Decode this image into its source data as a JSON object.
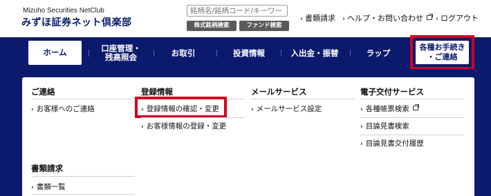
{
  "header": {
    "logo_en": "Mizuho Securities NetClub",
    "logo_ja": "みずほ証券ネット倶楽部",
    "search_placeholder": "銘柄名/銘柄コード/キーワード",
    "btn_stock_search": "株式銘柄検索",
    "btn_fund_search": "ファンド検索",
    "links": {
      "documents": "書類請求",
      "help": "ヘルプ・お問い合わせ",
      "logout": "ログアウト"
    }
  },
  "nav": {
    "home": "ホーム",
    "account_line1": "口座管理・",
    "account_line2": "残高照会",
    "trade": "お取引",
    "invest_info": "投資情報",
    "deposit": "入出金・振替",
    "wrap": "ラップ",
    "procedures_line1": "各種お手続き",
    "procedures_line2": "・ご連絡"
  },
  "menu": {
    "contact": {
      "heading": "ご連絡",
      "items": [
        "お客様へのご連絡"
      ]
    },
    "registration": {
      "heading": "登録情報",
      "items": [
        "登録情報の確認・変更",
        "お客様情報の登録・変更"
      ]
    },
    "mail": {
      "heading": "メールサービス",
      "items": [
        "メールサービス設定"
      ]
    },
    "edelivery": {
      "heading": "電子交付サービス",
      "items": [
        "各種帳票検索",
        "目論見書検索",
        "目論見書交付履歴"
      ]
    },
    "documents": {
      "heading": "書類請求",
      "items": [
        "書類一覧"
      ]
    }
  },
  "colors": {
    "navy": "#0c1a6e",
    "highlight_red": "#d4001e"
  },
  "icons": [
    "chevron-right-icon",
    "external-window-icon"
  ]
}
